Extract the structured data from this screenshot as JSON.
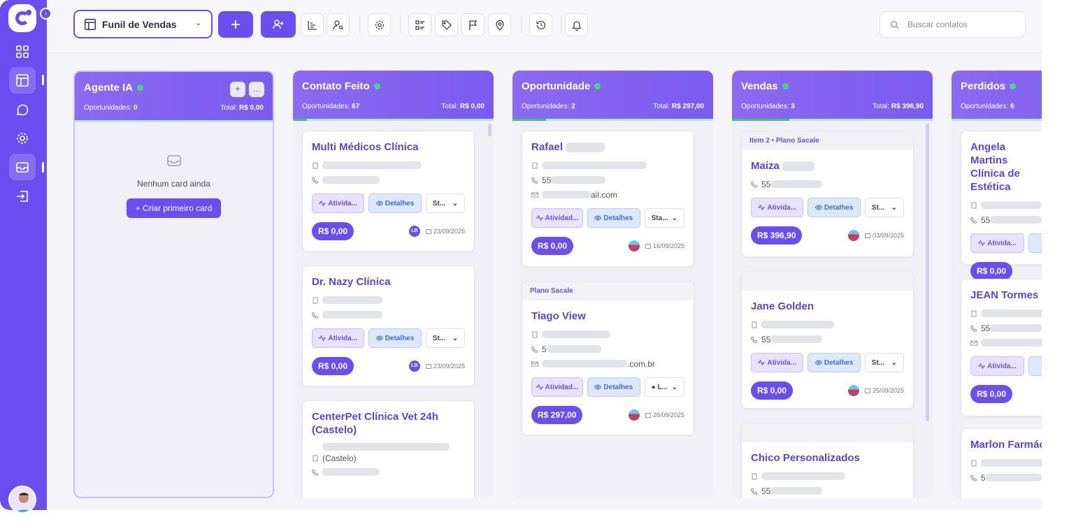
{
  "toolbar": {
    "funnel_label": "Funil de Vendas",
    "search_placeholder": "Buscar contatos"
  },
  "colors": {
    "primary": "#6b4ef0",
    "stage_ok": "#4ed18b",
    "header_gradient": "#8a6af2"
  },
  "icons": {
    "sidebar": [
      "dashboard-icon",
      "board-icon",
      "whatsapp-icon",
      "settings-icon",
      "inbox-icon",
      "import-icon"
    ],
    "toolbar": [
      "plus-icon",
      "add-user-icon",
      "chart-icon",
      "user-search-icon",
      "gear-icon",
      "list-icon",
      "tag-icon",
      "flag-icon",
      "map-pin-icon",
      "history-icon",
      "bell-icon"
    ]
  },
  "columns": [
    {
      "title": "Agente IA",
      "opp_label": "Oportunidades:",
      "opp_count": "0",
      "total_label": "Total:",
      "total_value": "R$ 0,00",
      "empty_text": "Nenhum card ainda",
      "create_label": "+ Criar primeiro card",
      "add_label": "+",
      "more_label": "...",
      "cards": []
    },
    {
      "title": "Contato Feito",
      "opp_label": "Oportunidades:",
      "opp_count": "67",
      "total_label": "Total:",
      "total_value": "R$ 0,00",
      "cards": [
        {
          "title": "Multi Médicos Clínica",
          "ativ": "Ativida...",
          "det": "Detalhes",
          "st": "St...",
          "price": "R$ 0,00",
          "user": "LB",
          "date": "23/09/2025"
        },
        {
          "title": "Dr. Nazy Clínica",
          "ativ": "Ativida...",
          "det": "Detalhes",
          "st": "St...",
          "price": "R$ 0,00",
          "user": "LB",
          "date": "23/09/2025"
        },
        {
          "title": "CenterPet Clínica Vet 24h (Castelo)",
          "extra": "(Castelo)"
        }
      ]
    },
    {
      "title": "Oportunidade",
      "opp_label": "Oportunidades:",
      "opp_count": "2",
      "total_label": "Total:",
      "total_value": "R$ 297,00",
      "cards": [
        {
          "title": "Rafael",
          "phone": "55",
          "email": "ail.com",
          "ativ": "Atividad...",
          "det": "Detalhes",
          "st": "Sta...",
          "price": "R$ 0,00",
          "date": "16/09/2025"
        },
        {
          "tag": "Plano Sacale",
          "title": "Tiago View",
          "phone": "5",
          "email": ".com.br",
          "ativ": "Atividad...",
          "det": "Detalhes",
          "st": "● L...",
          "price": "R$ 297,00",
          "date": "26/09/2025"
        }
      ]
    },
    {
      "title": "Vendas",
      "opp_label": "Oportunidades:",
      "opp_count": "3",
      "total_label": "Total:",
      "total_value": "R$ 396,90",
      "cards": [
        {
          "tag": "Item 2  •  Plano Sacale",
          "title": "Maiza",
          "phone": "55",
          "ativ": "Ativida...",
          "det": "Detalhes",
          "st": "St...",
          "price": "R$ 396,90",
          "date": "03/09/2025"
        },
        {
          "title": "Jane Golden",
          "phone": "55",
          "ativ": "Ativida...",
          "det": "Detalhes",
          "st": "St...",
          "price": "R$ 0,00",
          "date": "25/09/2025"
        },
        {
          "title": "Chico Personalizados",
          "phone": "55"
        }
      ]
    },
    {
      "title": "Perdidos",
      "opp_label": "Oportunidades:",
      "opp_count": "6",
      "cards": [
        {
          "title": "Angela Martins Clínica de Estética",
          "phone": "55",
          "ativ": "Ativida...",
          "price": "R$ 0,00"
        },
        {
          "title": "JEAN Tormes",
          "phone": "55",
          "ativ": "Ativida...",
          "price": "R$ 0,00"
        },
        {
          "title": "Marlon Farmácia",
          "phone": "5"
        }
      ]
    }
  ]
}
